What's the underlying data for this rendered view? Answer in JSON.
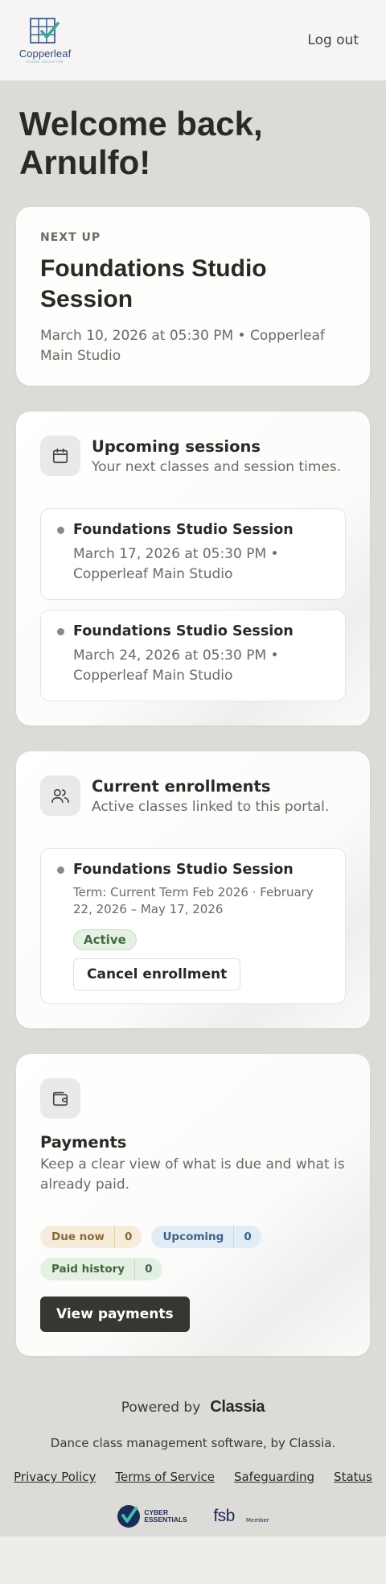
{
  "header": {
    "logo_name": "Copperleaf",
    "logo_sub": "STUDIO COLLECTIVE",
    "logout_label": "Log out"
  },
  "welcome": "Welcome back, Arnulfo!",
  "next_up": {
    "eyebrow": "NEXT UP",
    "title": "Foundations Studio Session",
    "meta": "March 10, 2026 at 05:30 PM • Copperleaf Main Studio"
  },
  "upcoming": {
    "icon": "calendar-icon",
    "title": "Upcoming sessions",
    "subtitle": "Your next classes and session times.",
    "items": [
      {
        "title": "Foundations Studio Session",
        "meta": "March 17, 2026 at 05:30 PM • Copperleaf Main Studio"
      },
      {
        "title": "Foundations Studio Session",
        "meta": "March 24, 2026 at 05:30 PM • Copperleaf Main Studio"
      }
    ]
  },
  "enrollments": {
    "icon": "users-icon",
    "title": "Current enrollments",
    "subtitle": "Active classes linked to this portal.",
    "items": [
      {
        "title": "Foundations Studio Session",
        "term": "Term: Current Term Feb 2026 · February 22, 2026 – May 17, 2026",
        "status": "Active",
        "cancel_label": "Cancel enrollment"
      }
    ]
  },
  "payments": {
    "icon": "wallet-icon",
    "title": "Payments",
    "subtitle": "Keep a clear view of what is due and what is already paid.",
    "pills": [
      {
        "label": "Due now",
        "count": "0"
      },
      {
        "label": "Upcoming",
        "count": "0"
      },
      {
        "label": "Paid history",
        "count": "0"
      }
    ],
    "button_label": "View payments"
  },
  "footer": {
    "powered_by": "Powered by",
    "brand": "Classia",
    "tagline": "Dance class management software, by Classia.",
    "links": [
      "Privacy Policy",
      "Terms of Service",
      "Safeguarding",
      "Status"
    ],
    "badge_ce": "CYBER ESSENTIALS",
    "badge_fsb": "fsb",
    "badge_fsb_member": "Member"
  },
  "colors": {
    "background": "#dcdbd8",
    "header": "#f6f5f3",
    "primary_button": "#383630",
    "active_badge": "#e6f1e6",
    "due_pill": "#f6ecdc",
    "upcoming_pill": "#e1edf6",
    "paid_pill": "#e4f0e3"
  }
}
